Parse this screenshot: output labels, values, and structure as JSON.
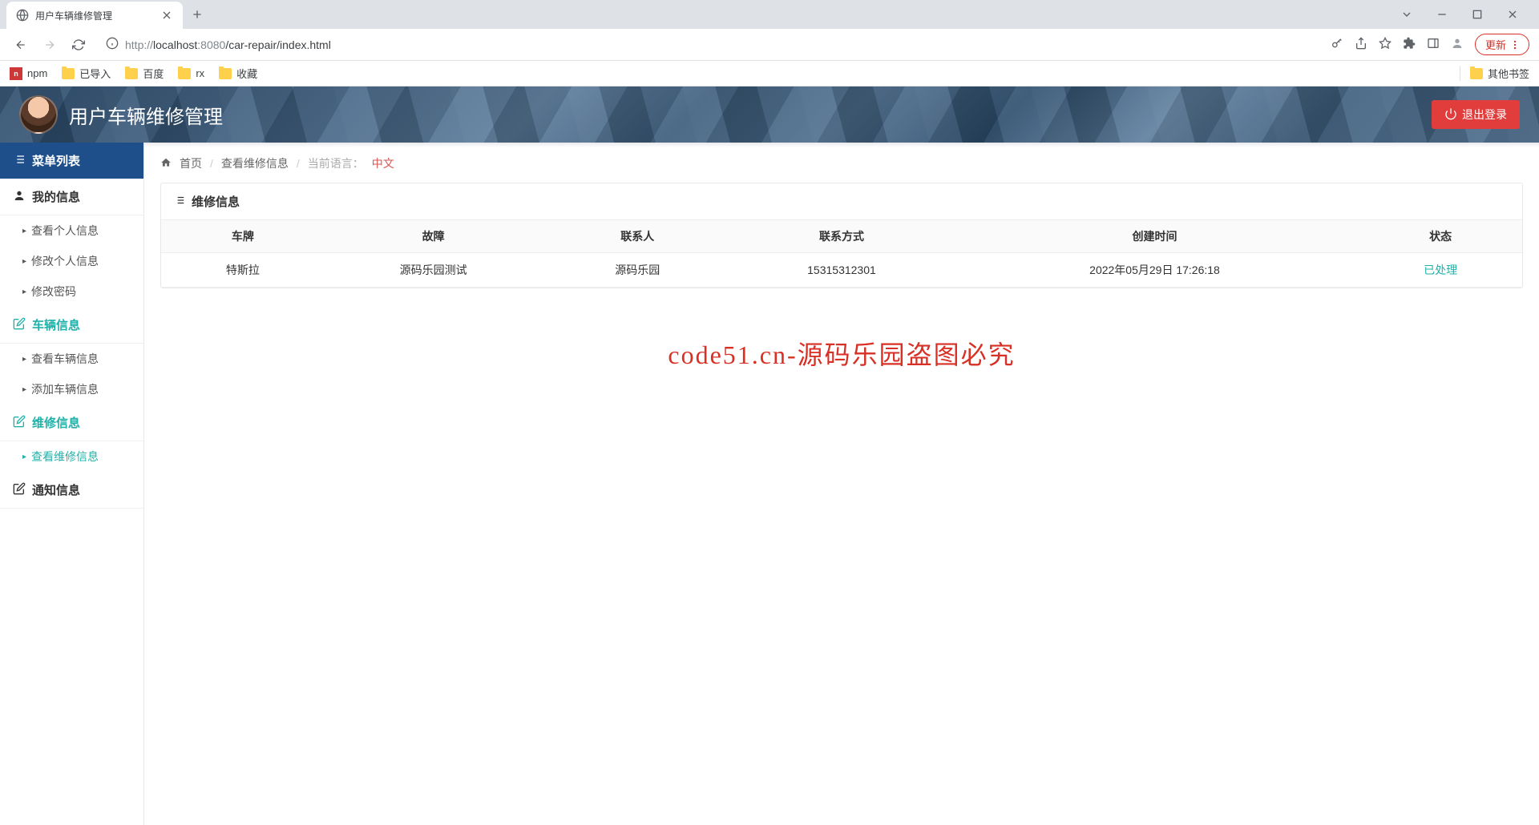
{
  "browser": {
    "tab_title": "用户车辆维修管理",
    "url_host": "localhost",
    "url_port": ":8080",
    "url_path": "/car-repair/index.html",
    "url_scheme": "http://",
    "update_label": "更新",
    "bookmarks": {
      "npm": "npm",
      "imported": "已导入",
      "baidu": "百度",
      "rx": "rx",
      "favorites": "收藏",
      "other": "其他书签"
    }
  },
  "banner": {
    "title": "用户车辆维修管理",
    "logout": "退出登录"
  },
  "sidebar": {
    "header": "菜单列表",
    "sections": {
      "my_info": "我的信息",
      "vehicle_info": "车辆信息",
      "repair_info": "维修信息",
      "notify_info": "通知信息"
    },
    "items": {
      "view_personal": "查看个人信息",
      "edit_personal": "修改个人信息",
      "edit_password": "修改密码",
      "view_vehicle": "查看车辆信息",
      "add_vehicle": "添加车辆信息",
      "view_repair": "查看维修信息"
    }
  },
  "breadcrumb": {
    "home": "首页",
    "current": "查看维修信息",
    "lang_label": "当前语言：",
    "lang_value": "中文"
  },
  "panel": {
    "title": "维修信息",
    "columns": {
      "plate": "车牌",
      "fault": "故障",
      "contact": "联系人",
      "phone": "联系方式",
      "created": "创建时间",
      "status": "状态"
    },
    "rows": [
      {
        "plate": "特斯拉",
        "fault": "源码乐园测试",
        "contact": "源码乐园",
        "phone": "15315312301",
        "created": "2022年05月29日 17:26:18",
        "status": "已处理"
      }
    ]
  },
  "watermark": "code51.cn-源码乐园盗图必究"
}
